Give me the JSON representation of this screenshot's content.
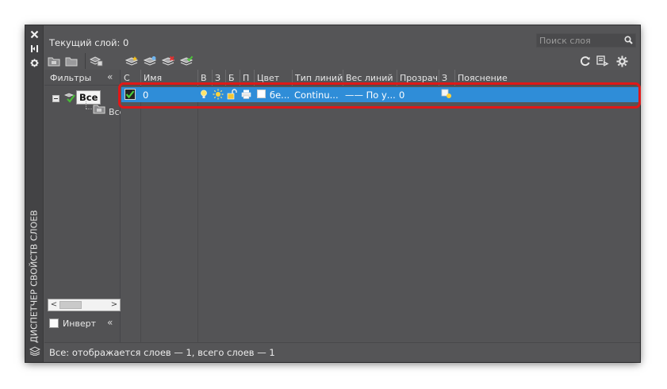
{
  "titlebar": {
    "title": "ДИСПЕТЧЕР СВОЙСТВ СЛОЕВ",
    "icons": [
      "close-icon",
      "autohide-icon",
      "properties-icon",
      "layers-icon"
    ]
  },
  "header": {
    "current_layer": "Текущий слой: 0",
    "search_placeholder": "Поиск слоя"
  },
  "toolbar": {
    "left_icons": [
      "new-property-filter-icon",
      "new-group-filter-icon",
      "layer-states-manager-icon",
      "new-layer-icon",
      "new-layer-vp-frozen-icon",
      "delete-layer-icon",
      "set-current-icon"
    ],
    "right_icons": [
      "refresh-icon",
      "layer-settings-icon",
      "settings-gear-icon"
    ]
  },
  "filters": {
    "title": "Фильтры",
    "collapse_glyph": "«",
    "tree": {
      "root_label": "Все",
      "child_label": "Все используемые слои"
    },
    "invert_label": "Инверт",
    "invert_checked": false
  },
  "grid": {
    "columns": [
      "С",
      "Имя",
      "В",
      "З",
      "Б",
      "П",
      "Цвет",
      "Тип линий",
      "Вес линий",
      "Прозрачность",
      "З",
      "Пояснение"
    ],
    "rows": [
      {
        "current": true,
        "name": "0",
        "on_icon": "lightbulb-on-icon",
        "freeze_icon": "sun-thawed-icon",
        "lock_icon": "unlocked-padlock-icon",
        "plot_icon": "printer-icon",
        "color_name": "бе...",
        "color_hex": "#ffffff",
        "linetype": "Continu...",
        "lineweight": "—— По у...",
        "transparency": "0",
        "new_vp_freeze_icon": "new-vp-freeze-icon",
        "description": ""
      }
    ]
  },
  "status": {
    "text": "Все: отображается слоев — 1, всего слоев — 1"
  },
  "colors": {
    "panel_bg": "#555557",
    "selection": "#2f8dd8",
    "highlight_ring": "#e01818"
  }
}
